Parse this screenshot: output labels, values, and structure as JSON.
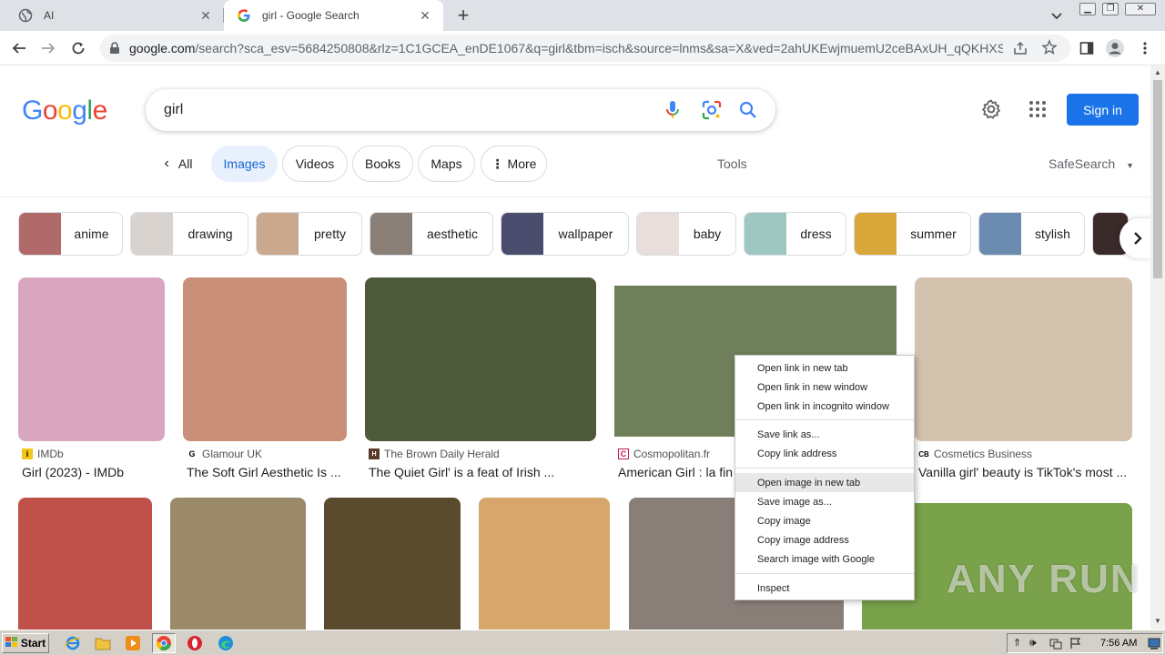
{
  "browser": {
    "tabs": [
      {
        "title": "AI",
        "active": false
      },
      {
        "title": "girl - Google Search",
        "active": true
      }
    ],
    "url_host": "google.com",
    "url_path": "/search?sca_esv=5684250808&rlz=1C1GCEA_enDE1067&q=girl&tbm=isch&source=lnms&sa=X&ved=2ahUKEwjmuemU2ceBAxUH_qQKHXSVC..."
  },
  "google": {
    "logo": [
      "G",
      "o",
      "o",
      "g",
      "l",
      "e"
    ],
    "logo_colors": [
      "#4285f4",
      "#ea4335",
      "#fbbc05",
      "#4285f4",
      "#34a853",
      "#ea4335"
    ],
    "query": "girl",
    "signin_label": "Sign in",
    "filters": {
      "all": "All",
      "images": "Images",
      "videos": "Videos",
      "books": "Books",
      "maps": "Maps",
      "more": "More",
      "tools": "Tools",
      "safesearch": "SafeSearch"
    },
    "related": [
      {
        "label": "anime",
        "color": "#b06a6a"
      },
      {
        "label": "drawing",
        "color": "#d8d3cf"
      },
      {
        "label": "pretty",
        "color": "#c9a88d"
      },
      {
        "label": "aesthetic",
        "color": "#8a7f76"
      },
      {
        "label": "wallpaper",
        "color": "#4a4d6e"
      },
      {
        "label": "baby",
        "color": "#e9dedb"
      },
      {
        "label": "dress",
        "color": "#9fc7c2"
      },
      {
        "label": "summer",
        "color": "#d9a63a"
      },
      {
        "label": "stylish",
        "color": "#6c8bb0"
      }
    ],
    "results_row1": [
      {
        "source": "IMDb",
        "title": "Girl (2023) - IMDb",
        "color": "#d9a6c0"
      },
      {
        "source": "Glamour UK",
        "title": "The Soft Girl Aesthetic Is ...",
        "color": "#c98f78"
      },
      {
        "source": "The Brown Daily Herald",
        "title": "The Quiet Girl' is a feat of Irish ...",
        "color": "#4f5a3a"
      },
      {
        "source": "Cosmopolitan.fr",
        "title": "American Girl : la fin",
        "color": "#6f7f5a"
      },
      {
        "source": "Cosmetics Business",
        "title": "Vanilla girl' beauty is TikTok's most ...",
        "color": "#d3c2ad"
      }
    ],
    "results_row2_colors": [
      "#c0504a",
      "#9a8a6a",
      "#5a4a2e",
      "#d6a66a",
      "#8a7f78",
      "#7aa24a"
    ]
  },
  "context_menu": {
    "items": [
      "Open link in new tab",
      "Open link in new window",
      "Open link in incognito window",
      "Save link as...",
      "Copy link address",
      "Open image in new tab",
      "Save image as...",
      "Copy image",
      "Copy image address",
      "Search image with Google",
      "Inspect"
    ],
    "highlighted": "Open image in new tab"
  },
  "watermark": "ANY RUN",
  "taskbar": {
    "start_label": "Start",
    "clock": "7:56 AM"
  }
}
